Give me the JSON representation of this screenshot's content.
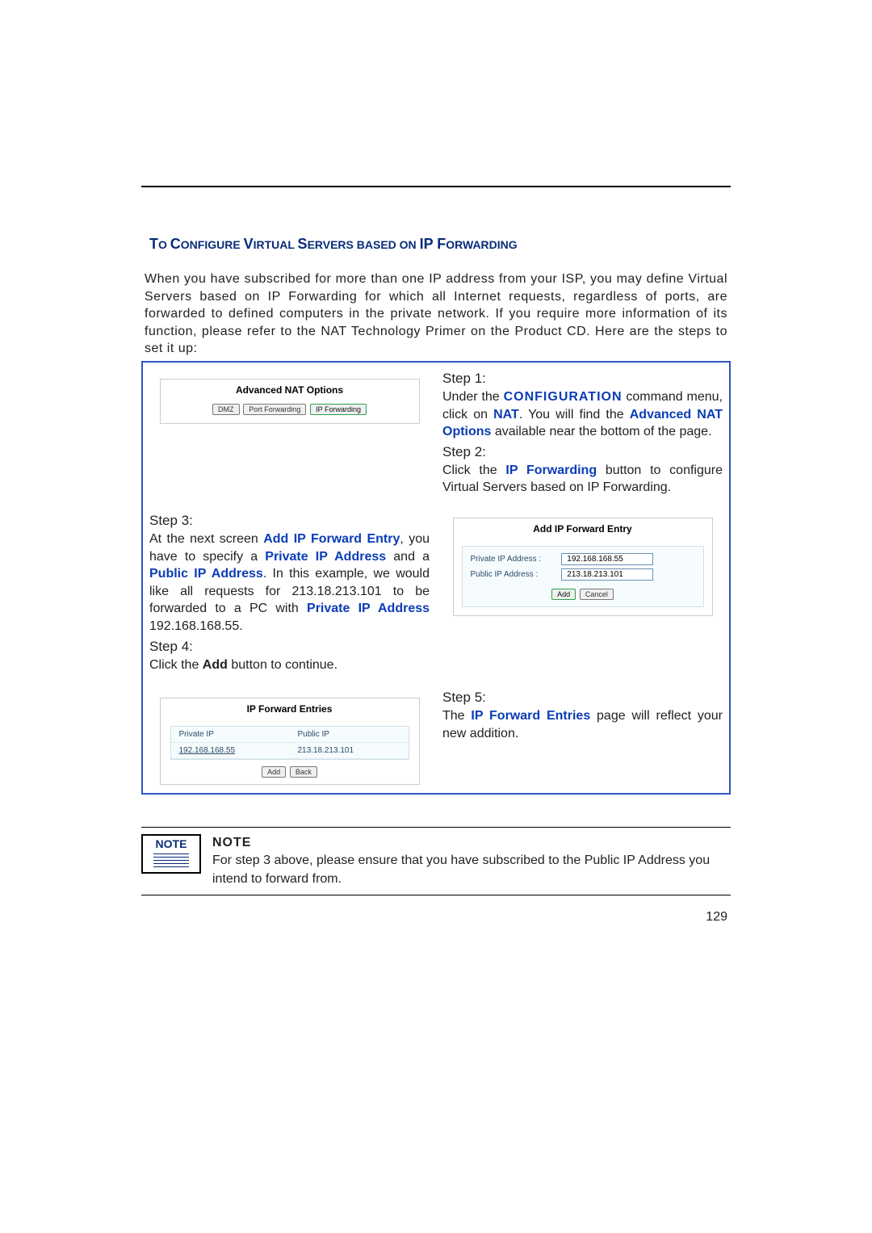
{
  "title_parts": {
    "p1": "T",
    "p2": "O ",
    "p3": "C",
    "p4": "ONFIGURE ",
    "p5": "V",
    "p6": "IRTUAL ",
    "p7": "S",
    "p8": "ERVERS BASED ON ",
    "p9": "IP F",
    "p10": "ORWARDING"
  },
  "intro": " When you have subscribed for more than one IP address  from your ISP, you may define Virtual Servers based on IP Forwarding for which all Internet requests, regardless of ports, are forwarded to defined computers in the private network. If you require more information of its function, please refer to the NAT Technology Primer on the Product CD. Here are the steps to set it up:",
  "panel1": {
    "title": "Advanced NAT Options",
    "btn1": "DMZ",
    "btn2": "Port Forwarding",
    "btn3": "IP Forwarding"
  },
  "step1": {
    "head": "Step 1:",
    "t1": "Under the ",
    "kw1": "CONFIGURATION",
    "t2": " command menu, click on ",
    "kw2": "NAT",
    "t3": ". You will find the ",
    "kw3": "Advanced NAT Options",
    "t4": " available near the bottom of the page."
  },
  "step2": {
    "head": "Step 2:",
    "t1": "Click the ",
    "kw1": "IP Forwarding",
    "t2": " button to configure Virtual Servers based on IP Forwarding."
  },
  "step3": {
    "head": "Step 3:",
    "t1": "At the next screen ",
    "kw1": "Add IP Forward Entry",
    "t2": ", you have to specify a ",
    "kw2": "Private IP Address",
    "t3": " and a ",
    "kw3": "Public IP Address",
    "t4": ". In this example, we would like all requests for 213.18.213.101 to be forwarded to a PC with ",
    "kw4": "Private IP Address",
    "t5": " 192.168.168.55."
  },
  "step4": {
    "head": "Step 4:",
    "t1": "Click the ",
    "kw1": "Add",
    "t2": " button to continue."
  },
  "add_entry": {
    "title": "Add IP Forward Entry",
    "l1": "Private IP Address :",
    "v1": "192.168.168.55",
    "l2": "Public IP Address :",
    "v2": "213.18.213.101",
    "btn1": "Add",
    "btn2": "Cancel"
  },
  "entries_panel": {
    "title": "IP Forward Entries",
    "col1": "Private IP",
    "col2": "Public IP",
    "r1c1": "192.168.168.55",
    "r1c2": "213.18.213.101",
    "btn1": "Add",
    "btn2": "Back"
  },
  "step5": {
    "head": "Step 5:",
    "t1": "The ",
    "kw1": "IP Forward Entries",
    "t2": " page will reflect your new addition."
  },
  "note": {
    "icon": "NOTE",
    "head": "NOTE",
    "body": "For step 3 above, please ensure that you have subscribed to the Public IP Address you intend to forward from."
  },
  "page_number": "129"
}
